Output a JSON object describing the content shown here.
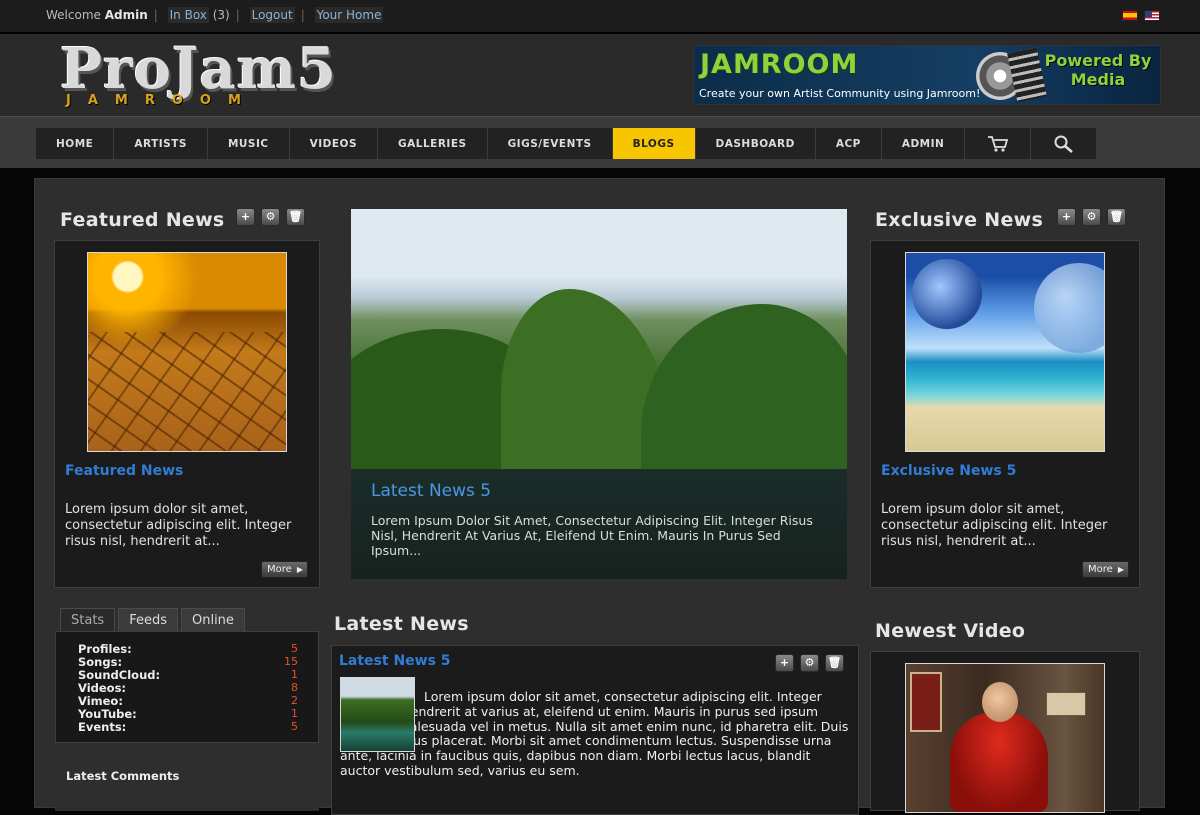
{
  "topbar": {
    "welcome_label": "Welcome",
    "user_name": "Admin",
    "inbox_label": "In Box",
    "inbox_count": "(3)",
    "logout_label": "Logout",
    "home_label": "Your Home",
    "flags": [
      "spanish-flag-icon",
      "us-flag-icon"
    ]
  },
  "header": {
    "logo_text": "ProJam5",
    "logo_sub": "JAMROOM",
    "banner": {
      "brand": "JAMROOM",
      "tagline": "Create your own Artist Community using Jamroom!",
      "powered_by": "Powered By Media"
    }
  },
  "nav": {
    "items": [
      "HOME",
      "ARTISTS",
      "MUSIC",
      "VIDEOS",
      "GALLERIES",
      "GIGS/EVENTS",
      "BLOGS",
      "DASHBOARD",
      "ACP",
      "ADMIN"
    ],
    "active": "BLOGS",
    "icons": [
      "cart-icon",
      "search-icon"
    ]
  },
  "featured": {
    "heading": "Featured News",
    "title": "Featured News",
    "text": "Lorem ipsum dolor sit amet, consectetur adipiscing elit. Integer risus nisl, hendrerit at...",
    "more_label": "More"
  },
  "slider": {
    "title": "Latest News 5",
    "text": "Lorem Ipsum Dolor Sit Amet, Consectetur Adipiscing Elit. Integer Risus Nisl, Hendrerit At Varius At, Eleifend Ut Enim. Mauris In Purus Sed Ipsum..."
  },
  "exclusive": {
    "heading": "Exclusive News",
    "title": "Exclusive News 5",
    "text": "Lorem ipsum dolor sit amet, consectetur adipiscing elit. Integer risus nisl, hendrerit at...",
    "more_label": "More"
  },
  "tabs": {
    "items": [
      "Stats",
      "Feeds",
      "Online"
    ],
    "active": "Stats"
  },
  "stats": [
    {
      "label": "Profiles:",
      "value": "5"
    },
    {
      "label": "Songs:",
      "value": "15"
    },
    {
      "label": "SoundCloud:",
      "value": "1"
    },
    {
      "label": "Videos:",
      "value": "8"
    },
    {
      "label": "Vimeo:",
      "value": "2"
    },
    {
      "label": "YouTube:",
      "value": "1"
    },
    {
      "label": "Events:",
      "value": "5"
    }
  ],
  "latest_comments": {
    "heading": "Latest Comments"
  },
  "latest_news": {
    "heading": "Latest News",
    "title": "Latest News 5",
    "text": "Lorem ipsum dolor sit amet, consectetur adipiscing elit. Integer risus nisl, hendrerit at varius at, eleifend ut enim. Mauris in purus sed ipsum molestie malesuada vel in metus. Nulla sit amet enim nunc, id pharetra elit. Duis tempor varius placerat. Morbi sit amet condimentum lectus. Suspendisse urna ante, lacinia in faucibus quis, dapibus non diam. Morbi lectus lacus, blandit auctor vestibulum sed, varius eu sem."
  },
  "newest_video": {
    "heading": "Newest Video"
  },
  "controls": {
    "add": "+",
    "settings": "⚙",
    "delete": "🗑"
  }
}
